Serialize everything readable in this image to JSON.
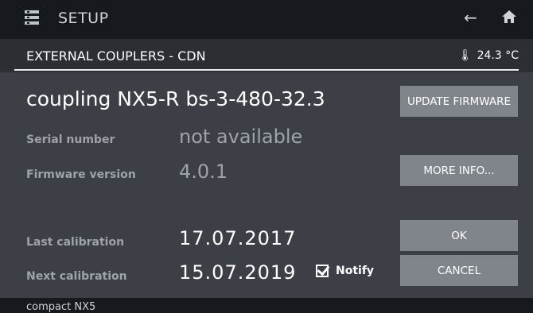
{
  "header": {
    "title": "SETUP",
    "menu_icon": "menu-icon",
    "back_icon": "arrow-left-icon",
    "home_icon": "home-icon"
  },
  "subheader": {
    "title": "EXTERNAL COUPLERS - CDN",
    "temperature": "24.3 °C",
    "temperature_icon": "thermometer-icon"
  },
  "device": {
    "name": "coupling NX5-R bs-3-480-32.3"
  },
  "fields": {
    "serial_label": "Serial number",
    "serial_value": "not available",
    "firmware_label": "Firmware version",
    "firmware_value": "4.0.1",
    "last_cal_label": "Last calibration",
    "last_cal_value": "17.07.2017",
    "next_cal_label": "Next calibration",
    "next_cal_value": "15.07.2019"
  },
  "notify": {
    "label": "Notify",
    "checked": true
  },
  "buttons": {
    "update_firmware": "UPDATE FIRMWARE",
    "more_info": "MORE INFO...",
    "ok": "OK",
    "cancel": "CANCEL"
  },
  "footer": {
    "text": "compact NX5"
  },
  "colors": {
    "background": "#3c4046",
    "header_bg": "#16191e",
    "button_bg": "#80858c",
    "muted_text": "#9ea3aa"
  }
}
